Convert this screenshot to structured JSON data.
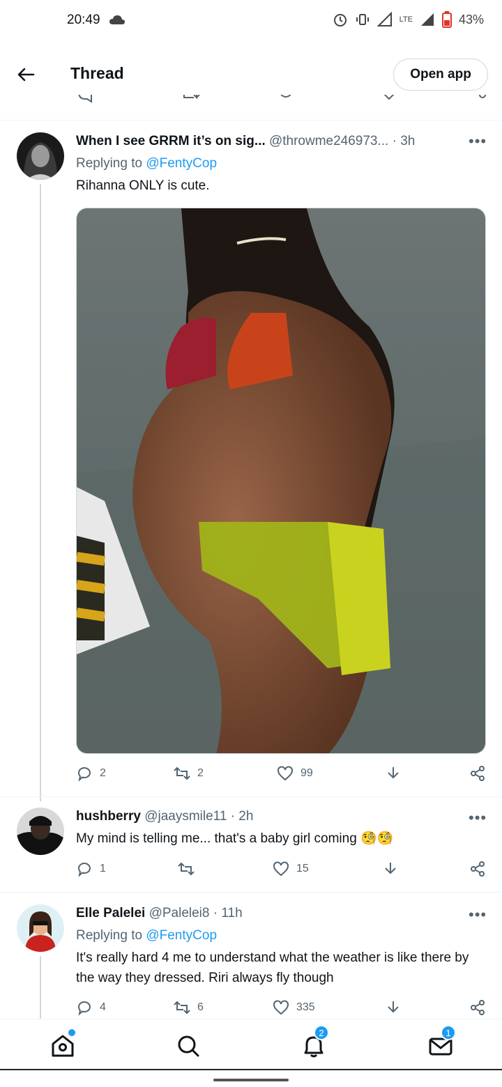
{
  "status": {
    "time": "20:49",
    "network": "LTE",
    "battery": "43%"
  },
  "header": {
    "title": "Thread",
    "open_app": "Open app"
  },
  "colors": {
    "accent": "#1d9bf0",
    "text": "#0f1419",
    "muted": "#536471",
    "border": "#cfd9de"
  },
  "tweets": [
    {
      "name": "When I see GRRM it’s on sig...",
      "handle": "@throwme246973...",
      "time": "· 3h",
      "replying_label": "Replying to",
      "replying_to": "@FentyCop",
      "text": "Rihanna ONLY is cute.",
      "replies": "2",
      "retweets": "2",
      "likes": "99"
    },
    {
      "name": "hushberry",
      "handle": "@jaaysmile11",
      "time": "· 2h",
      "text": "My mind is telling me... that's a baby girl coming 🧐🧐",
      "replies": "1",
      "retweets": "",
      "likes": "15"
    },
    {
      "name": "Elle Palelei",
      "handle": "@Palelei8",
      "time": "· 11h",
      "replying_label": "Replying to",
      "replying_to": "@FentyCop",
      "text": "It's really hard 4 me to understand what the weather is like there by the way they dressed. Riri always fly though",
      "replies": "4",
      "retweets": "6",
      "likes": "335"
    }
  ],
  "nav": {
    "home_icon": "home-icon",
    "search_icon": "search-icon",
    "notifications_badge": "2",
    "messages_badge": "1"
  }
}
